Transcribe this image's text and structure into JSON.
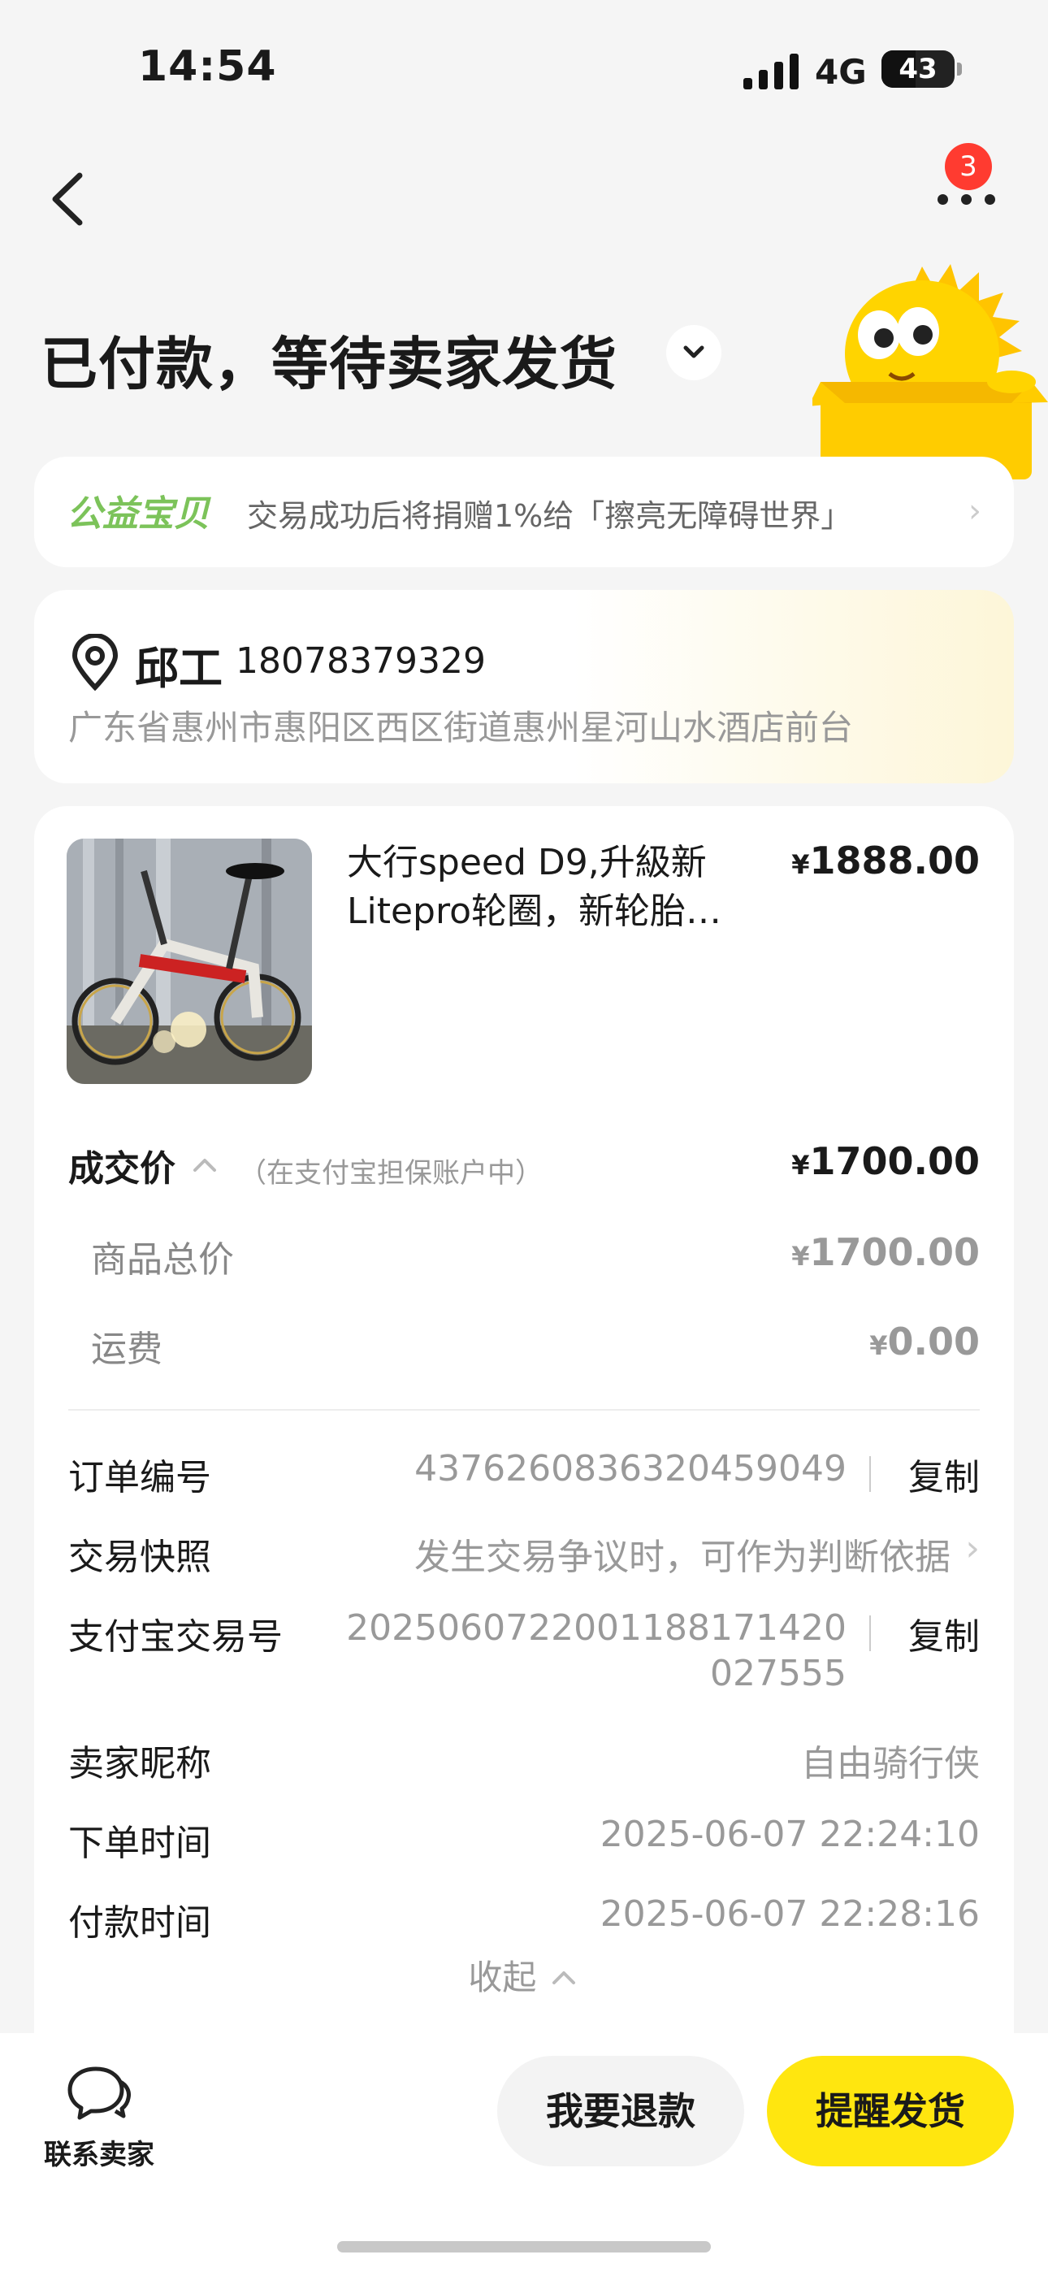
{
  "status_bar": {
    "time": "14:54",
    "network": "4G",
    "battery": "43"
  },
  "nav": {
    "badge_count": "3"
  },
  "header": {
    "title": "已付款，等待卖家发货"
  },
  "charity": {
    "tag": "公益宝贝",
    "text": "交易成功后将捐赠1%给「擦亮无障碍世界」"
  },
  "address": {
    "name": "邱工",
    "phone": "18078379329",
    "line": "广东省惠州市惠阳区西区街道惠州星河山水酒店前台"
  },
  "product": {
    "title": "大行speed D9,升級新Litepro轮圈，新轮胎…",
    "price": "1888.00",
    "currency": "¥"
  },
  "pricing": {
    "deal_label": "成交价",
    "deal_hint": "（在支付宝担保账户中）",
    "deal_value": "1700.00",
    "total_label": "商品总价",
    "total_value": "1700.00",
    "shipping_label": "运费",
    "shipping_value": "0.00"
  },
  "details": {
    "order_no_label": "订单编号",
    "order_no": "4376260836320459049",
    "copy": "复制",
    "snapshot_label": "交易快照",
    "snapshot_value": "发生交易争议时，可作为判断依据",
    "alipay_label": "支付宝交易号",
    "alipay_no_line1": "2025060722001188171420",
    "alipay_no_line2": "027555",
    "seller_label": "卖家昵称",
    "seller_value": "自由骑行侠",
    "order_time_label": "下单时间",
    "order_time": "2025-06-07 22:24:10",
    "pay_time_label": "付款时间",
    "pay_time": "2025-06-07 22:28:16",
    "collapse": "收起"
  },
  "bottom_bar": {
    "contact_label": "联系卖家",
    "refund_label": "我要退款",
    "remind_label": "提醒发货"
  },
  "colors": {
    "accent": "#ffe60f",
    "charity_green": "#7cc35a",
    "badge": "#ff3b30"
  }
}
